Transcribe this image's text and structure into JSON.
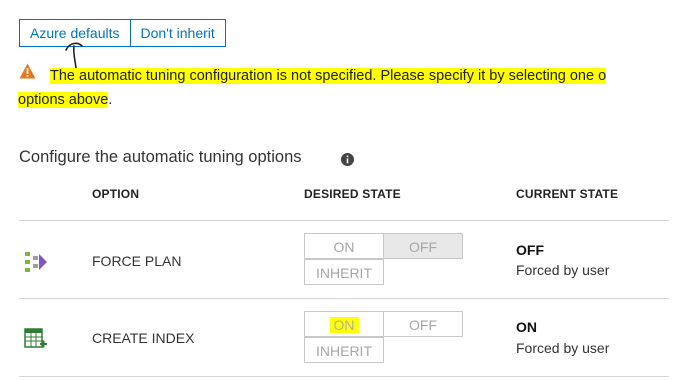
{
  "inherit_options": {
    "azure_defaults": "Azure defaults",
    "dont_inherit": "Don't inherit"
  },
  "warning": {
    "line1": "The automatic tuning configuration is not specified. Please specify it by selecting one o",
    "line2": "options above",
    "line2_suffix": "."
  },
  "section": {
    "title": "Configure the automatic tuning options"
  },
  "table": {
    "headers": {
      "option": "OPTION",
      "desired": "DESIRED STATE",
      "current": "CURRENT STATE"
    },
    "rows": [
      {
        "option": "FORCE PLAN",
        "on": "ON",
        "off": "OFF",
        "inherit": "INHERIT",
        "current_state": "OFF",
        "current_detail": "Forced by user"
      },
      {
        "option": "CREATE INDEX",
        "on": "ON",
        "off": "OFF",
        "inherit": "INHERIT",
        "current_state": "ON",
        "current_detail": "Forced by user"
      }
    ]
  },
  "colors": {
    "accent": "#0072c6",
    "highlight": "#ffff00",
    "warning": "#e8771a"
  }
}
